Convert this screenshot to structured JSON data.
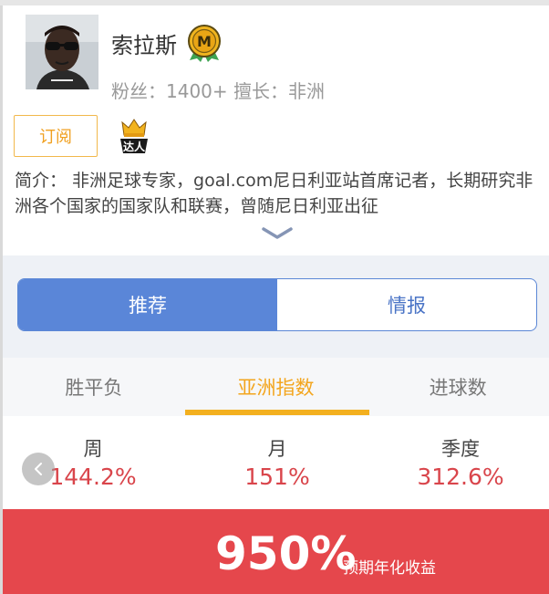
{
  "profile": {
    "name": "索拉斯",
    "fans_label": "粉丝：",
    "fans_value": "1400+",
    "skill_label": "擅长：",
    "skill_value": "非洲",
    "medal_letter": "M",
    "subscribe_label": "订阅",
    "badge_text": "达人",
    "bio": "简介： 非洲足球专家，goal.com尼日利亚站首席记者，长期研究非洲各个国家的国家队和联赛，曾随尼日利亚出征"
  },
  "segment": {
    "items": [
      "推荐",
      "情报"
    ],
    "active": 0
  },
  "tabs": {
    "items": [
      "胜平负",
      "亚洲指数",
      "进球数"
    ],
    "active": 1
  },
  "stats": {
    "periods": [
      "周",
      "月",
      "季度"
    ],
    "values": [
      "144.2%",
      "151%",
      "312.6%"
    ]
  },
  "footer": {
    "value": "950%",
    "label": "预期年化收益"
  },
  "colors": {
    "accent_blue": "#5a86d8",
    "accent_orange": "#f3a51d",
    "value_red": "#d9454b",
    "footer_red": "#e5474c"
  },
  "icons": {
    "medal": "m-medal-icon",
    "badge": "daren-badge-icon",
    "expand": "chevron-down-icon",
    "back": "chevron-left-icon"
  }
}
